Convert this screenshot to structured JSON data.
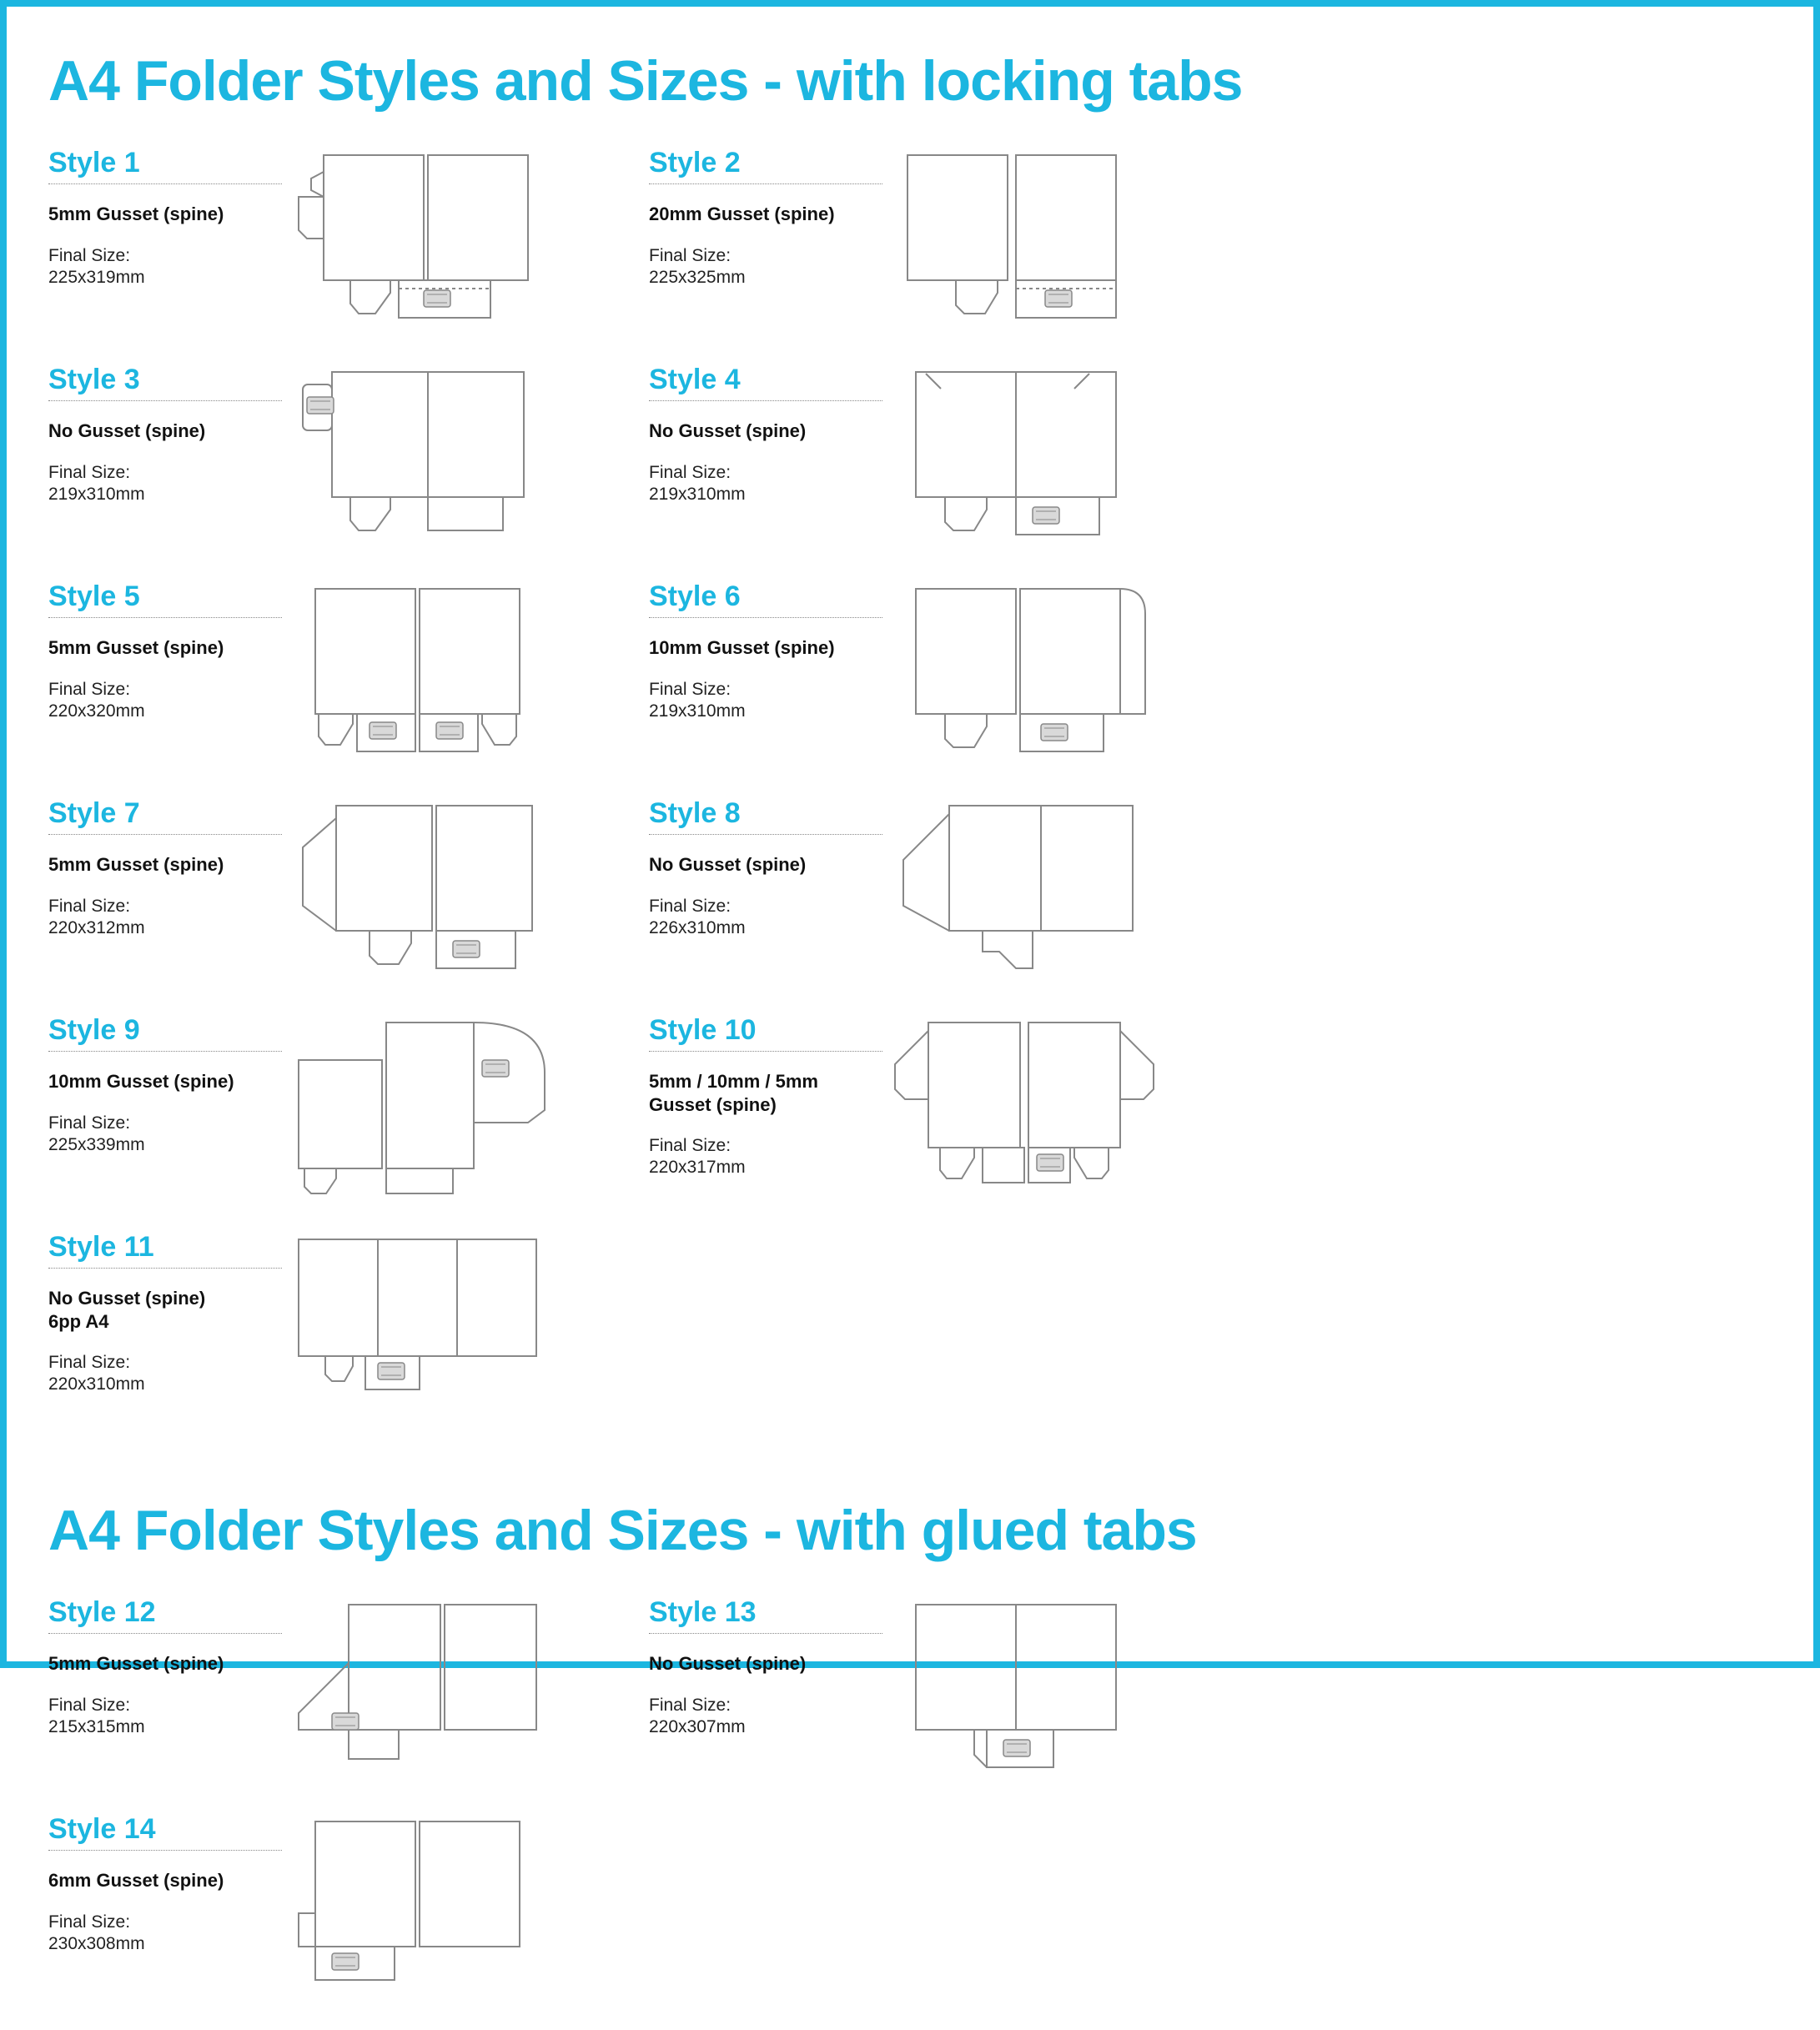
{
  "section1_title": "A4 Folder Styles and Sizes - with locking tabs",
  "section2_title": "A4 Folder Styles and Sizes - with glued tabs",
  "final_label": "Final Size:",
  "styles": [
    {
      "name": "Style 1",
      "gusset": "5mm Gusset (spine)",
      "size": "225x319mm",
      "svg": "s1",
      "group": 1
    },
    {
      "name": "Style 2",
      "gusset": "20mm Gusset (spine)",
      "size": "225x325mm",
      "svg": "s2",
      "group": 1
    },
    {
      "name": "Style 3",
      "gusset": "No Gusset (spine)",
      "size": "219x310mm",
      "svg": "s3",
      "group": 1
    },
    {
      "name": "Style 4",
      "gusset": "No Gusset (spine)",
      "size": "219x310mm",
      "svg": "s4",
      "group": 1
    },
    {
      "name": "Style 5",
      "gusset": "5mm Gusset (spine)",
      "size": "220x320mm",
      "svg": "s5",
      "group": 1
    },
    {
      "name": "Style 6",
      "gusset": "10mm Gusset (spine)",
      "size": "219x310mm",
      "svg": "s6",
      "group": 1
    },
    {
      "name": "Style 7",
      "gusset": "5mm Gusset (spine)",
      "size": "220x312mm",
      "svg": "s7",
      "group": 1
    },
    {
      "name": "Style 8",
      "gusset": "No Gusset (spine)",
      "size": "226x310mm",
      "svg": "s8",
      "group": 1
    },
    {
      "name": "Style 9",
      "gusset": "10mm Gusset (spine)",
      "size": "225x339mm",
      "svg": "s9",
      "group": 1
    },
    {
      "name": "Style 10",
      "gusset": "5mm / 10mm / 5mm\nGusset (spine)",
      "size": "220x317mm",
      "svg": "s10",
      "group": 1
    },
    {
      "name": "Style 11",
      "gusset": "No Gusset (spine)\n6pp A4",
      "size": "220x310mm",
      "svg": "s11",
      "group": 1
    },
    {
      "name": "Style 12",
      "gusset": "5mm Gusset (spine)",
      "size": "215x315mm",
      "svg": "s12",
      "group": 2
    },
    {
      "name": "Style 13",
      "gusset": "No Gusset (spine)",
      "size": "220x307mm",
      "svg": "s13",
      "group": 2
    },
    {
      "name": "Style 14",
      "gusset": "6mm Gusset (spine)",
      "size": "230x308mm",
      "svg": "s14",
      "group": 2
    }
  ]
}
